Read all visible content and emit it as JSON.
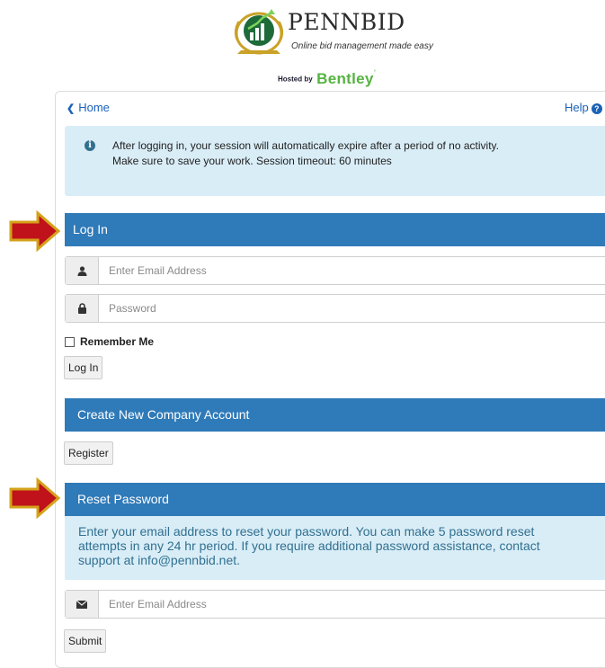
{
  "header": {
    "brand_title": "PENNBID",
    "tagline": "Online bid management made easy",
    "hosted_prefix": "Hosted by",
    "hosted_brand": "Bentley"
  },
  "nav": {
    "home_label": "Home",
    "help_label": "Help",
    "help_icon_glyph": "?"
  },
  "notice": {
    "icon_glyph": "i",
    "line1": "After logging in, your session will automatically expire after a period of no activity.",
    "line2": "Make sure to save your work. Session timeout: 60 minutes"
  },
  "login": {
    "heading": "Log In",
    "email_placeholder": "Enter Email Address",
    "password_placeholder": "Password",
    "remember_label": "Remember Me",
    "button_label": "Log In"
  },
  "create_account": {
    "heading": "Create New Company Account",
    "button_label": "Register"
  },
  "reset": {
    "heading": "Reset Password",
    "info_lines": [
      "Enter your email address to reset your password. You can make 5 password reset",
      "attempts in any 24 hr period. If you require additional password assistance, contact",
      "support at info@pennbid.net."
    ],
    "email_placeholder": "Enter Email Address",
    "button_label": "Submit"
  },
  "icons": {
    "user": "user-icon",
    "lock": "lock-icon",
    "envelope": "envelope-icon",
    "info": "info-circle-icon",
    "help": "question-circle-icon",
    "chevron": "chevron-left-icon",
    "arrow": "red-arrow-icon"
  },
  "colors": {
    "section_header": "#2f7ab8",
    "info_bg": "#d9edf7",
    "info_text": "#31708f",
    "link": "#1a62b7",
    "arrow_fill": "#c0121a",
    "arrow_border": "#d4a21a",
    "bentley_green": "#55b441"
  }
}
